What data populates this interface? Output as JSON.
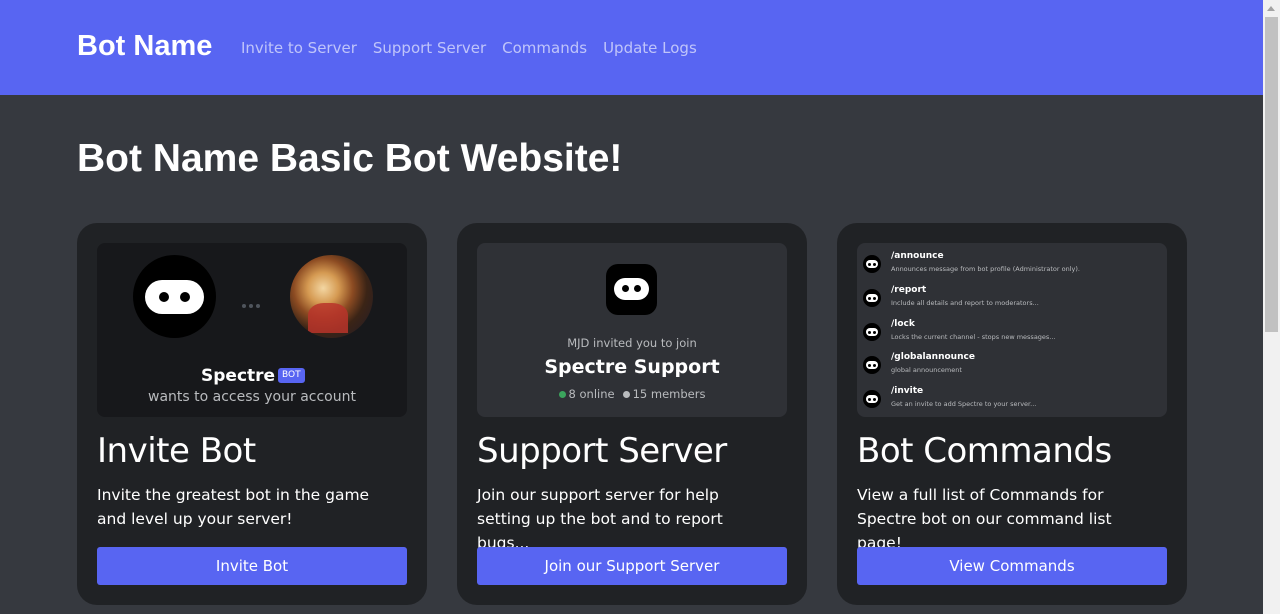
{
  "navbar": {
    "brand": "Bot Name",
    "links": [
      "Invite to Server",
      "Support Server",
      "Commands",
      "Update Logs"
    ]
  },
  "page_title": "Bot Name Basic Bot Website!",
  "cards": [
    {
      "title": "Invite Bot",
      "text": "Invite the greatest bot in the game and level up your server!",
      "button": "Invite Bot",
      "image": {
        "bot_name": "Spectre",
        "badge": "BOT",
        "subtitle": "wants to access your account"
      }
    },
    {
      "title": "Support Server",
      "text": "Join our support server for help setting up the bot and to report bugs...",
      "button": "Join our Support Server",
      "image": {
        "invited_text": "MJD invited you to join",
        "server_name": "Spectre Support",
        "online": "8 online",
        "members": "15 members"
      }
    },
    {
      "title": "Bot Commands",
      "text": "View a full list of Commands for Spectre bot on our command list page!",
      "button": "View Commands",
      "image": {
        "commands": [
          {
            "name": "/announce",
            "desc": "Announces message from bot profile (Administrator only)."
          },
          {
            "name": "/report",
            "desc": "Include all details and report to moderators..."
          },
          {
            "name": "/lock",
            "desc": "Locks the current channel - stops new messages..."
          },
          {
            "name": "/globalannounce",
            "desc": "global announcement"
          },
          {
            "name": "/invite",
            "desc": "Get an invite to add Spectre to your server..."
          }
        ]
      }
    }
  ],
  "colors": {
    "navbar": "#5865f2",
    "background": "#36393f",
    "card": "#202225",
    "button": "#5865f2",
    "online": "#3ba55d"
  }
}
